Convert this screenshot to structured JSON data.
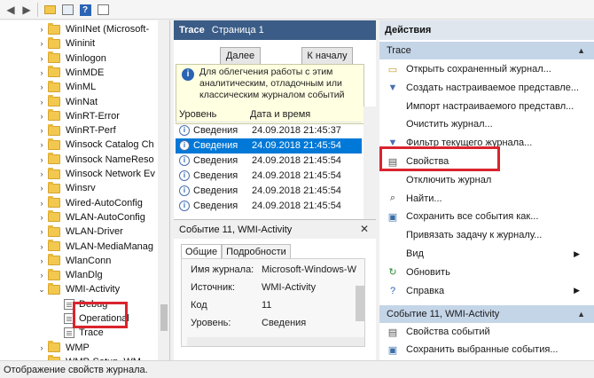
{
  "toolbar": {
    "buttons": [
      "back-icon",
      "forward-icon",
      "up-folder-icon",
      "show-hide-icon",
      "help-icon",
      "properties-icon"
    ]
  },
  "tree": {
    "items": [
      {
        "label": "WinINet (Microsoft-",
        "type": "folder",
        "arrow": "›"
      },
      {
        "label": "Wininit",
        "type": "folder",
        "arrow": "›"
      },
      {
        "label": "Winlogon",
        "type": "folder",
        "arrow": "›"
      },
      {
        "label": "WinMDE",
        "type": "folder",
        "arrow": "›"
      },
      {
        "label": "WinML",
        "type": "folder",
        "arrow": "›"
      },
      {
        "label": "WinNat",
        "type": "folder",
        "arrow": "›"
      },
      {
        "label": "WinRT-Error",
        "type": "folder",
        "arrow": "›"
      },
      {
        "label": "WinRT-Perf",
        "type": "folder",
        "arrow": "›"
      },
      {
        "label": "Winsock Catalog Ch",
        "type": "folder",
        "arrow": "›"
      },
      {
        "label": "Winsock NameReso",
        "type": "folder",
        "arrow": "›"
      },
      {
        "label": "Winsock Network Ev",
        "type": "folder",
        "arrow": "›"
      },
      {
        "label": "Winsrv",
        "type": "folder",
        "arrow": "›"
      },
      {
        "label": "Wired-AutoConfig",
        "type": "folder",
        "arrow": "›"
      },
      {
        "label": "WLAN-AutoConfig",
        "type": "folder",
        "arrow": "›"
      },
      {
        "label": "WLAN-Driver",
        "type": "folder",
        "arrow": "›"
      },
      {
        "label": "WLAN-MediaManag",
        "type": "folder",
        "arrow": "›"
      },
      {
        "label": "WlanConn",
        "type": "folder",
        "arrow": "›"
      },
      {
        "label": "WlanDlg",
        "type": "folder",
        "arrow": "›"
      },
      {
        "label": "WMI-Activity",
        "type": "folder",
        "arrow": "⌄"
      },
      {
        "label": "Debug",
        "type": "log",
        "arrow": ""
      },
      {
        "label": "Operational",
        "type": "log",
        "arrow": ""
      },
      {
        "label": "Trace",
        "type": "log",
        "arrow": ""
      },
      {
        "label": "WMP",
        "type": "folder",
        "arrow": "›"
      },
      {
        "label": "WMP-Setup_WM",
        "type": "folder",
        "arrow": "›"
      }
    ]
  },
  "middle": {
    "header_title": "Trace",
    "header_sub": "Страница 1",
    "next_button": "Далее",
    "start_button": "К началу",
    "info_text": "Для облегчения работы с этим аналитическим, отладочным или классическим журналом событий",
    "columns": [
      "Уровень",
      "Дата и время"
    ],
    "rows": [
      {
        "level": "Сведения",
        "time": "24.09.2018 21:45:37"
      },
      {
        "level": "Сведения",
        "time": "24.09.2018 21:45:54"
      },
      {
        "level": "Сведения",
        "time": "24.09.2018 21:45:54"
      },
      {
        "level": "Сведения",
        "time": "24.09.2018 21:45:54"
      },
      {
        "level": "Сведения",
        "time": "24.09.2018 21:45:54"
      },
      {
        "level": "Сведения",
        "time": "24.09.2018 21:45:54"
      }
    ],
    "selected_row": 1,
    "event_title": "Событие 11, WMI-Activity",
    "tab_general": "Общие",
    "tab_details": "Подробности",
    "details": [
      {
        "label": "Имя журнала:",
        "value": "Microsoft-Windows-WI"
      },
      {
        "label": "Источник:",
        "value": "WMI-Activity"
      },
      {
        "label": "Код",
        "value": "11"
      },
      {
        "label": "Уровень:",
        "value": "Сведения"
      }
    ]
  },
  "actions": {
    "header": "Действия",
    "section1": "Trace",
    "items1": [
      {
        "label": "Открыть сохраненный журнал...",
        "icon": "open-folder-icon",
        "more": false
      },
      {
        "label": "Создать настраиваемое представле...",
        "icon": "filter-add-icon",
        "more": false
      },
      {
        "label": "Импорт настраиваемого представл...",
        "icon": "",
        "more": false
      },
      {
        "label": "Очистить журнал...",
        "icon": "",
        "more": false
      },
      {
        "label": "Фильтр текущего журнала...",
        "icon": "filter-icon",
        "more": false
      },
      {
        "label": "Свойства",
        "icon": "properties-icon",
        "more": false
      },
      {
        "label": "Отключить журнал",
        "icon": "",
        "more": false
      },
      {
        "label": "Найти...",
        "icon": "find-icon",
        "more": false
      },
      {
        "label": "Сохранить все события как...",
        "icon": "save-icon",
        "more": false
      },
      {
        "label": "Привязать задачу к журналу...",
        "icon": "",
        "more": false
      },
      {
        "label": "Вид",
        "icon": "",
        "more": true
      },
      {
        "label": "Обновить",
        "icon": "refresh-icon",
        "more": false
      },
      {
        "label": "Справка",
        "icon": "help-icon",
        "more": true
      }
    ],
    "section2": "Событие 11, WMI-Activity",
    "items2": [
      {
        "label": "Свойства событий",
        "icon": "event-properties-icon"
      },
      {
        "label": "Сохранить выбранные события...",
        "icon": "save-icon"
      }
    ]
  },
  "status": {
    "text": "Отображение свойств журнала."
  },
  "colors": {
    "header_blue": "#3b5c86",
    "selection": "#0078d7",
    "highlight_red": "#d9242e",
    "section_blue": "#c5d5e8"
  }
}
